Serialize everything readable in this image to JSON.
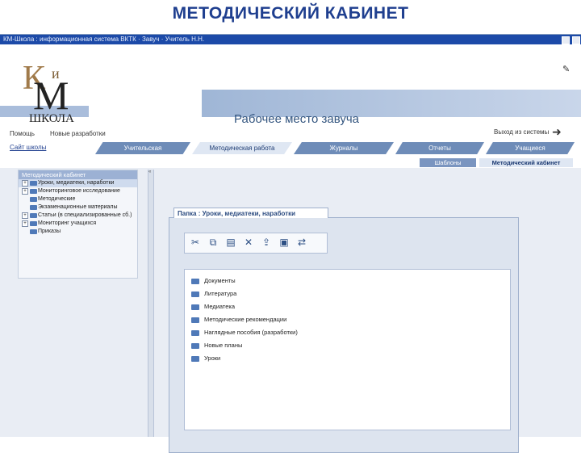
{
  "slide_title": "МЕТОДИЧЕСКИЙ КАБИНЕТ",
  "window": {
    "title": "КМ-Школа : информационная система ВКТК · Завуч · Учитель Н.Н.",
    "min_icon": "minimize-icon",
    "close_icon": "close-icon"
  },
  "header": {
    "logo": {
      "k": "К",
      "i": "и",
      "m": "М",
      "school": "ШКОЛА"
    },
    "workplace_title": "Рабочее место завуча",
    "nav_help": "Помощь",
    "nav_news": "Новые разработки",
    "site_link": "Сайт школы",
    "exit_label": "Выход из системы",
    "exit_icon": "arrow-right-icon",
    "edit_icon": "pencil-icon"
  },
  "main_tabs": [
    {
      "label": "Учительская",
      "active": false
    },
    {
      "label": "Методическая работа",
      "active": true
    },
    {
      "label": "Журналы",
      "active": false
    },
    {
      "label": "Отчеты",
      "active": false
    },
    {
      "label": "Учащиеся",
      "active": false
    }
  ],
  "sub_tabs": [
    {
      "label": "Шаблоны",
      "active": false
    },
    {
      "label": "Методический кабинет",
      "active": true
    }
  ],
  "tree": {
    "header": "Методический кабинет",
    "items": [
      {
        "label": "Уроки, медиатеки, наработки",
        "expander": "+",
        "selected": true
      },
      {
        "label": "Мониторинговое исследование",
        "expander": "+",
        "selected": false
      },
      {
        "label": "Методические",
        "expander": "",
        "selected": false
      },
      {
        "label": "Экзаменационные материалы",
        "expander": "",
        "selected": false
      },
      {
        "label": "Статьи (в специализированные сб.)",
        "expander": "+",
        "selected": false
      },
      {
        "label": "Мониторинг учащихся",
        "expander": "+",
        "selected": false
      },
      {
        "label": "Приказы",
        "expander": "",
        "selected": false
      }
    ]
  },
  "panel": {
    "tab_label": "Папка : Уроки, медиатеки, наработки",
    "tools": [
      {
        "name": "cut-icon",
        "glyph": "✂"
      },
      {
        "name": "copy-icon",
        "glyph": "⧉"
      },
      {
        "name": "paste-icon",
        "glyph": "▤"
      },
      {
        "name": "delete-icon",
        "glyph": "✕"
      },
      {
        "name": "upload-icon",
        "glyph": "⇪"
      },
      {
        "name": "new-file-icon",
        "glyph": "▣"
      },
      {
        "name": "rename-icon",
        "glyph": "⇄"
      }
    ],
    "files": [
      "Документы",
      "Литература",
      "Медиатека",
      "Методические рекомендации",
      "Наглядные пособия (разработки)",
      "Новые планы",
      "Уроки"
    ]
  }
}
